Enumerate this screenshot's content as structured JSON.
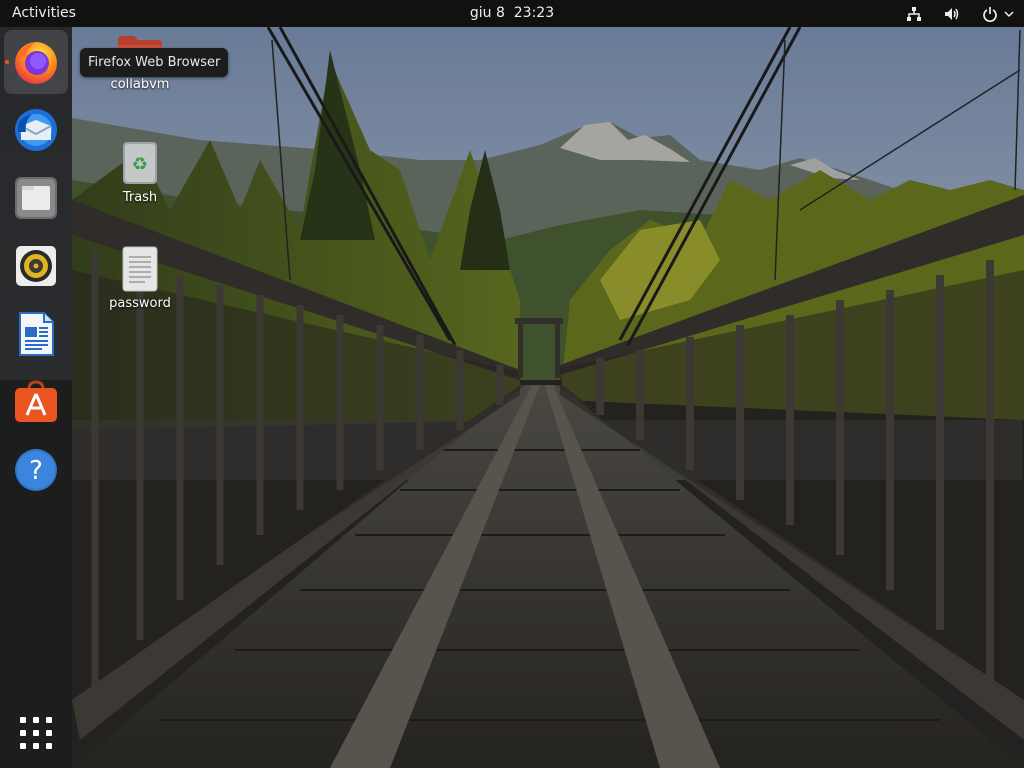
{
  "topbar": {
    "activities_label": "Activities",
    "clock_text": "giu 8  23:23",
    "status_icons": [
      "network-icon",
      "volume-icon",
      "power-icon",
      "chevron-down-icon"
    ]
  },
  "dock": {
    "items": [
      {
        "id": "firefox",
        "name": "Firefox Web Browser",
        "icon": "firefox-icon",
        "running": true
      },
      {
        "id": "thunderbird",
        "name": "Thunderbird Mail",
        "icon": "thunderbird-icon",
        "running": false
      },
      {
        "id": "files",
        "name": "Files",
        "icon": "files-icon",
        "running": false
      },
      {
        "id": "rhythmbox",
        "name": "Rhythmbox",
        "icon": "rhythmbox-icon",
        "running": false
      },
      {
        "id": "writer",
        "name": "LibreOffice Writer",
        "icon": "writer-icon",
        "running": false
      },
      {
        "id": "software",
        "name": "Ubuntu Software",
        "icon": "software-icon",
        "running": false
      },
      {
        "id": "help",
        "name": "Help",
        "icon": "help-icon",
        "running": false
      }
    ],
    "show_apps_icon": "show-applications-icon"
  },
  "tooltip": {
    "text": "Firefox Web Browser"
  },
  "desktop": {
    "icons": [
      {
        "label": "collabvm",
        "icon": "folder-icon"
      },
      {
        "label": "Trash",
        "icon": "trash-icon"
      },
      {
        "label": "password",
        "icon": "text-file-icon"
      }
    ]
  },
  "colors": {
    "accent": "#e95420",
    "topbar_bg": "#111111",
    "dock_bg": "#1c1c1c",
    "folder": "#cf4f3a"
  }
}
